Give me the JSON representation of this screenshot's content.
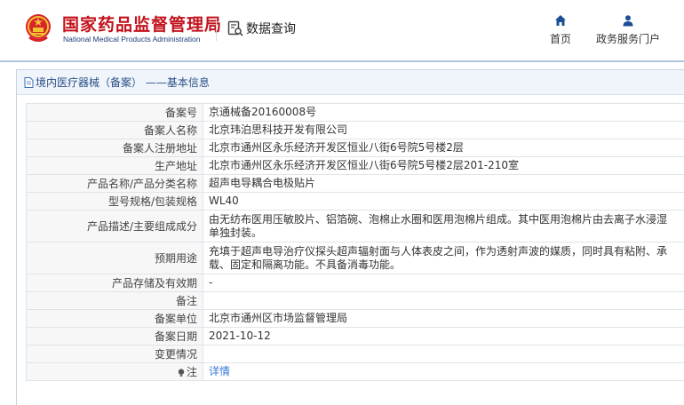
{
  "header": {
    "site_name_cn": "国家药品监督管理局",
    "site_name_en": "National Medical Products Administration",
    "query_label": "数据查询",
    "nav": [
      {
        "label": "首页",
        "icon": "home-icon"
      },
      {
        "label": "政务服务门户",
        "icon": "user-icon"
      }
    ]
  },
  "breadcrumb": "境内医疗器械（备案） ——基本信息",
  "colors": {
    "brand_red": "#c3121c",
    "brand_blue": "#1d3d7a",
    "link_blue": "#3a7bd5",
    "breadcrumb_bg": "#f0f5fb"
  },
  "record": [
    {
      "label": "备案号",
      "value": "京通械备20160008号"
    },
    {
      "label": "备案人名称",
      "value": "北京玮泊思科技开发有限公司"
    },
    {
      "label": "备案人注册地址",
      "value": "北京市通州区永乐经济开发区恒业八街6号院5号楼2层"
    },
    {
      "label": "生产地址",
      "value": "北京市通州区永乐经济开发区恒业八街6号院5号楼2层201-210室"
    },
    {
      "label": "产品名称/产品分类名称",
      "value": "超声电导耦合电极贴片"
    },
    {
      "label": "型号规格/包装规格",
      "value": "WL40"
    },
    {
      "label": "产品描述/主要组成成分",
      "value": "由无纺布医用压敏胶片、铝箔碗、泡棉止水圈和医用泡棉片组成。其中医用泡棉片由去离子水浸湿单独封装。"
    },
    {
      "label": "预期用途",
      "value": "充填于超声电导治疗仪探头超声辐射面与人体表皮之间，作为透射声波的媒质，同时具有粘附、承载、固定和隔离功能。不具备消毒功能。"
    },
    {
      "label": "产品存储及有效期",
      "value": "-"
    },
    {
      "label": "备注",
      "value": ""
    },
    {
      "label": "备案单位",
      "value": "北京市通州区市场监督管理局"
    },
    {
      "label": "备案日期",
      "value": "2021-10-12"
    },
    {
      "label": "变更情况",
      "value": ""
    },
    {
      "label": "注",
      "value": "详情"
    }
  ]
}
